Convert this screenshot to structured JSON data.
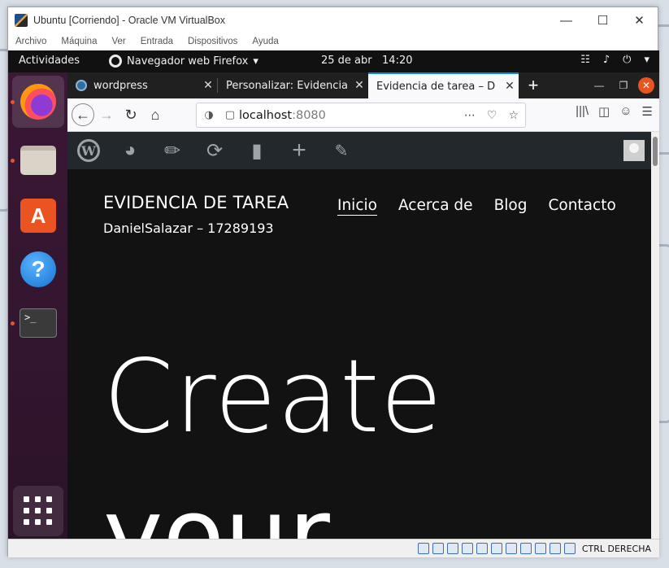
{
  "vbox": {
    "title": "Ubuntu [Corriendo] - Oracle VM VirtualBox",
    "menu": [
      "Archivo",
      "Máquina",
      "Ver",
      "Entrada",
      "Dispositivos",
      "Ayuda"
    ],
    "host_key_label": "CTRL DERECHA"
  },
  "gnome": {
    "activities": "Actividades",
    "app_menu": "Navegador web Firefox",
    "date": "25 de abr",
    "time": "14:20"
  },
  "firefox": {
    "tabs": [
      {
        "label": "wordpress"
      },
      {
        "label": "Personalizar: Evidencia"
      },
      {
        "label": "Evidencia de tarea – D"
      }
    ],
    "url_host": "localhost",
    "url_port": ":8080"
  },
  "site": {
    "title": "EVIDENCIA DE TAREA",
    "description": "DanielSalazar – 17289193",
    "menu": [
      "Inicio",
      "Acerca de",
      "Blog",
      "Contacto"
    ],
    "hero_line1": "Create",
    "hero_line2": "your"
  },
  "colors": {
    "dock": "#2c1329",
    "accent": "#e95420",
    "wp_admin_bar": "#23282d",
    "page_bg": "#121212",
    "tab_active_border": "#0a84ff"
  }
}
